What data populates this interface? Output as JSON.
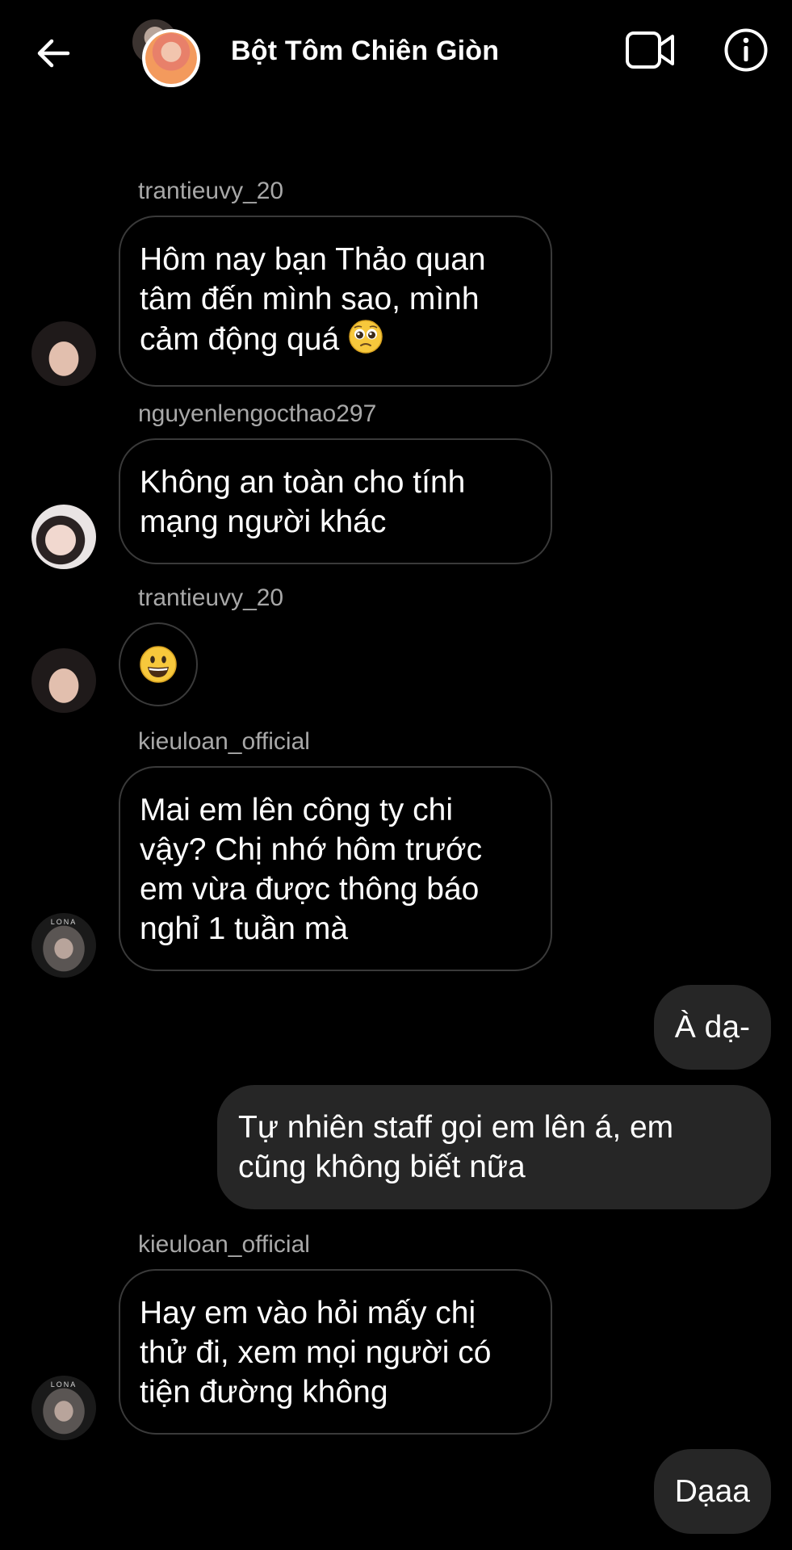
{
  "header": {
    "title": "Bột Tôm Chiên Giòn",
    "back_icon": "arrow-left-icon",
    "video_icon": "video-camera-icon",
    "info_icon": "info-circle-icon"
  },
  "messages": {
    "m1": {
      "sender": "trantieuvy_20",
      "text": "Hôm nay bạn Thảo quan tâm đến mình sao, mình cảm động quá",
      "emoji": "pleading-face"
    },
    "m2": {
      "sender": "nguyenlengocthao297",
      "text": "Không an toàn cho tính mạng người khác"
    },
    "m3": {
      "sender": "trantieuvy_20",
      "emoji": "grinning-face"
    },
    "m4": {
      "sender": "kieuloan_official",
      "text": "Mai em lên công ty chi vậy? Chị nhớ hôm trước em vừa được thông báo nghỉ 1 tuần mà"
    },
    "m5": {
      "text": "À dạ-"
    },
    "m6": {
      "text": "Tự nhiên staff gọi em lên á, em cũng không biết nữa"
    },
    "m7": {
      "sender": "kieuloan_official",
      "text": "Hay em vào hỏi mấy chị thử đi, xem mọi người có tiện đường không"
    },
    "m8": {
      "text": "Dạaa"
    }
  },
  "avatars": {
    "kieuloan_tag": "LONA"
  },
  "colors": {
    "background": "#000000",
    "incoming_border": "#3a3a3a",
    "outgoing_bg": "#262626",
    "sender_name": "#a8a8a8"
  }
}
